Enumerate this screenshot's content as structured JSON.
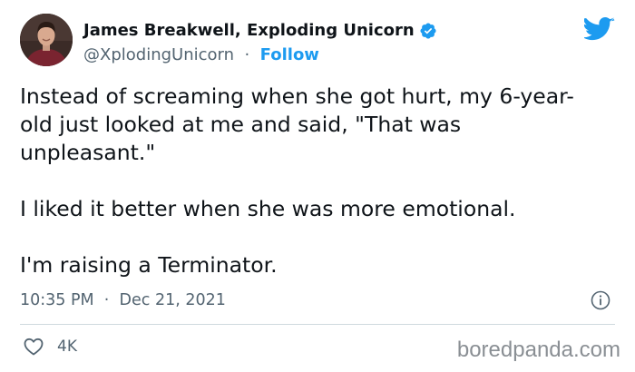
{
  "author": {
    "display_name": "James Breakwell, Exploding Unicorn",
    "handle": "@XplodingUnicorn",
    "separator": "·",
    "follow_label": "Follow"
  },
  "tweet": {
    "paragraphs": [
      "Instead of screaming when she got hurt, my 6-year-old just looked at me and said, \"That was unpleasant.\"",
      "I liked it better when she was more emotional.",
      "I'm raising a Terminator."
    ],
    "time": "10:35 PM",
    "date": "Dec 21, 2021",
    "meta_separator": "·"
  },
  "actions": {
    "like_count": "4K"
  },
  "watermark": "boredpanda.com",
  "icons": {
    "verified": "verified-badge-icon",
    "brand": "twitter-bird-icon",
    "info": "info-icon",
    "like": "heart-icon"
  },
  "colors": {
    "accent": "#1d9bf0",
    "text": "#0f1419",
    "secondary": "#536471",
    "divider": "#cfd9de",
    "watermark": "#8a8f94"
  }
}
